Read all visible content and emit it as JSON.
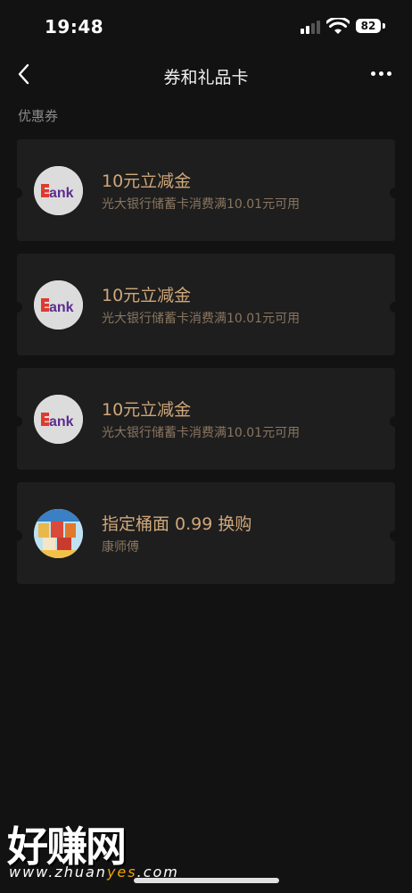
{
  "status": {
    "time": "19:48",
    "battery": "82"
  },
  "nav": {
    "title": "券和礼品卡"
  },
  "section": {
    "label": "优惠券"
  },
  "coupons": [
    {
      "title": "10元立减金",
      "desc": "光大银行储蓄卡消费满10.01元可用",
      "icon": "bank-logo"
    },
    {
      "title": "10元立减金",
      "desc": "光大银行储蓄卡消费满10.01元可用",
      "icon": "bank-logo"
    },
    {
      "title": "10元立减金",
      "desc": "光大银行储蓄卡消费满10.01元可用",
      "icon": "bank-logo"
    },
    {
      "title": "指定桶面 0.99 换购",
      "desc": "康师傅",
      "icon": "noodle-product-image"
    }
  ],
  "watermark": {
    "text": "好赚网",
    "url_prefix": "www.zhuan",
    "url_highlight": "yes",
    "url_suffix": ".com"
  },
  "colors": {
    "background": "#121212",
    "card": "#1e1e1e",
    "title": "#cfa77a",
    "desc": "#8a7560"
  }
}
